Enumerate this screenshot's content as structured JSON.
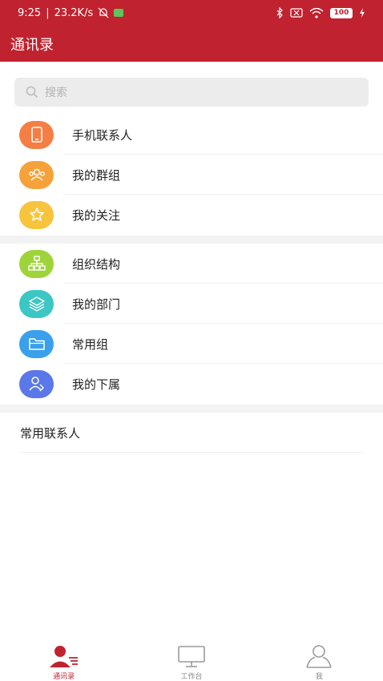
{
  "status_bar": {
    "time": "9:25",
    "speed": "23.2K/s",
    "battery": "100"
  },
  "app_bar": {
    "title": "通讯录"
  },
  "search": {
    "placeholder": "搜索"
  },
  "group1": [
    {
      "label": "手机联系人",
      "icon": "phone-icon",
      "color": "#f57e45"
    },
    {
      "label": "我的群组",
      "icon": "group-icon",
      "color": "#f5a23a"
    },
    {
      "label": "我的关注",
      "icon": "star-icon",
      "color": "#f7c43d"
    }
  ],
  "group2": [
    {
      "label": "组织结构",
      "icon": "org-chart-icon",
      "color": "#9fd33a"
    },
    {
      "label": "我的部门",
      "icon": "layers-icon",
      "color": "#3cc7c4"
    },
    {
      "label": "常用组",
      "icon": "folder-icon",
      "color": "#3aa0ec"
    },
    {
      "label": "我的下属",
      "icon": "subordinate-icon",
      "color": "#5b78e8"
    }
  ],
  "frequent_contacts": {
    "label": "常用联系人"
  },
  "tabs": [
    {
      "label": "通讯录",
      "icon": "contacts-icon",
      "active": true
    },
    {
      "label": "工作台",
      "icon": "monitor-icon",
      "active": false
    },
    {
      "label": "我",
      "icon": "person-icon",
      "active": false
    }
  ],
  "colors": {
    "primary": "#c0222f",
    "background": "#ffffff",
    "separator": "#f3f3f3"
  }
}
